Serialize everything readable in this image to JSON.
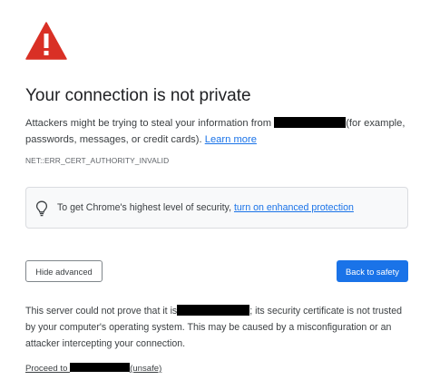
{
  "heading": {
    "icon": "warning-triangle-icon",
    "title": "Your connection is not private"
  },
  "description": {
    "before": "Attackers might be trying to steal your information from ",
    "after": "(for example, passwords, messages, or credit cards). ",
    "learn_more": "Learn more"
  },
  "error_code": "NET::ERR_CERT_AUTHORITY_INVALID",
  "protection": {
    "icon": "lightbulb-icon",
    "text": "To get Chrome's highest level of security, ",
    "link": "turn on enhanced protection"
  },
  "buttons": {
    "hide_advanced": "Hide advanced",
    "back_to_safety": "Back to safety"
  },
  "details": {
    "before": "This server could not prove that it is",
    "after": "; its security certificate is not trusted by your computer's operating system. This may be caused by a misconfiguration or an attacker intercepting your connection."
  },
  "proceed": {
    "before": "Proceed to ",
    "after": "(unsafe)"
  },
  "colors": {
    "warning_red": "#d93025",
    "link_blue": "#1a73e8",
    "redaction": "#000000"
  }
}
